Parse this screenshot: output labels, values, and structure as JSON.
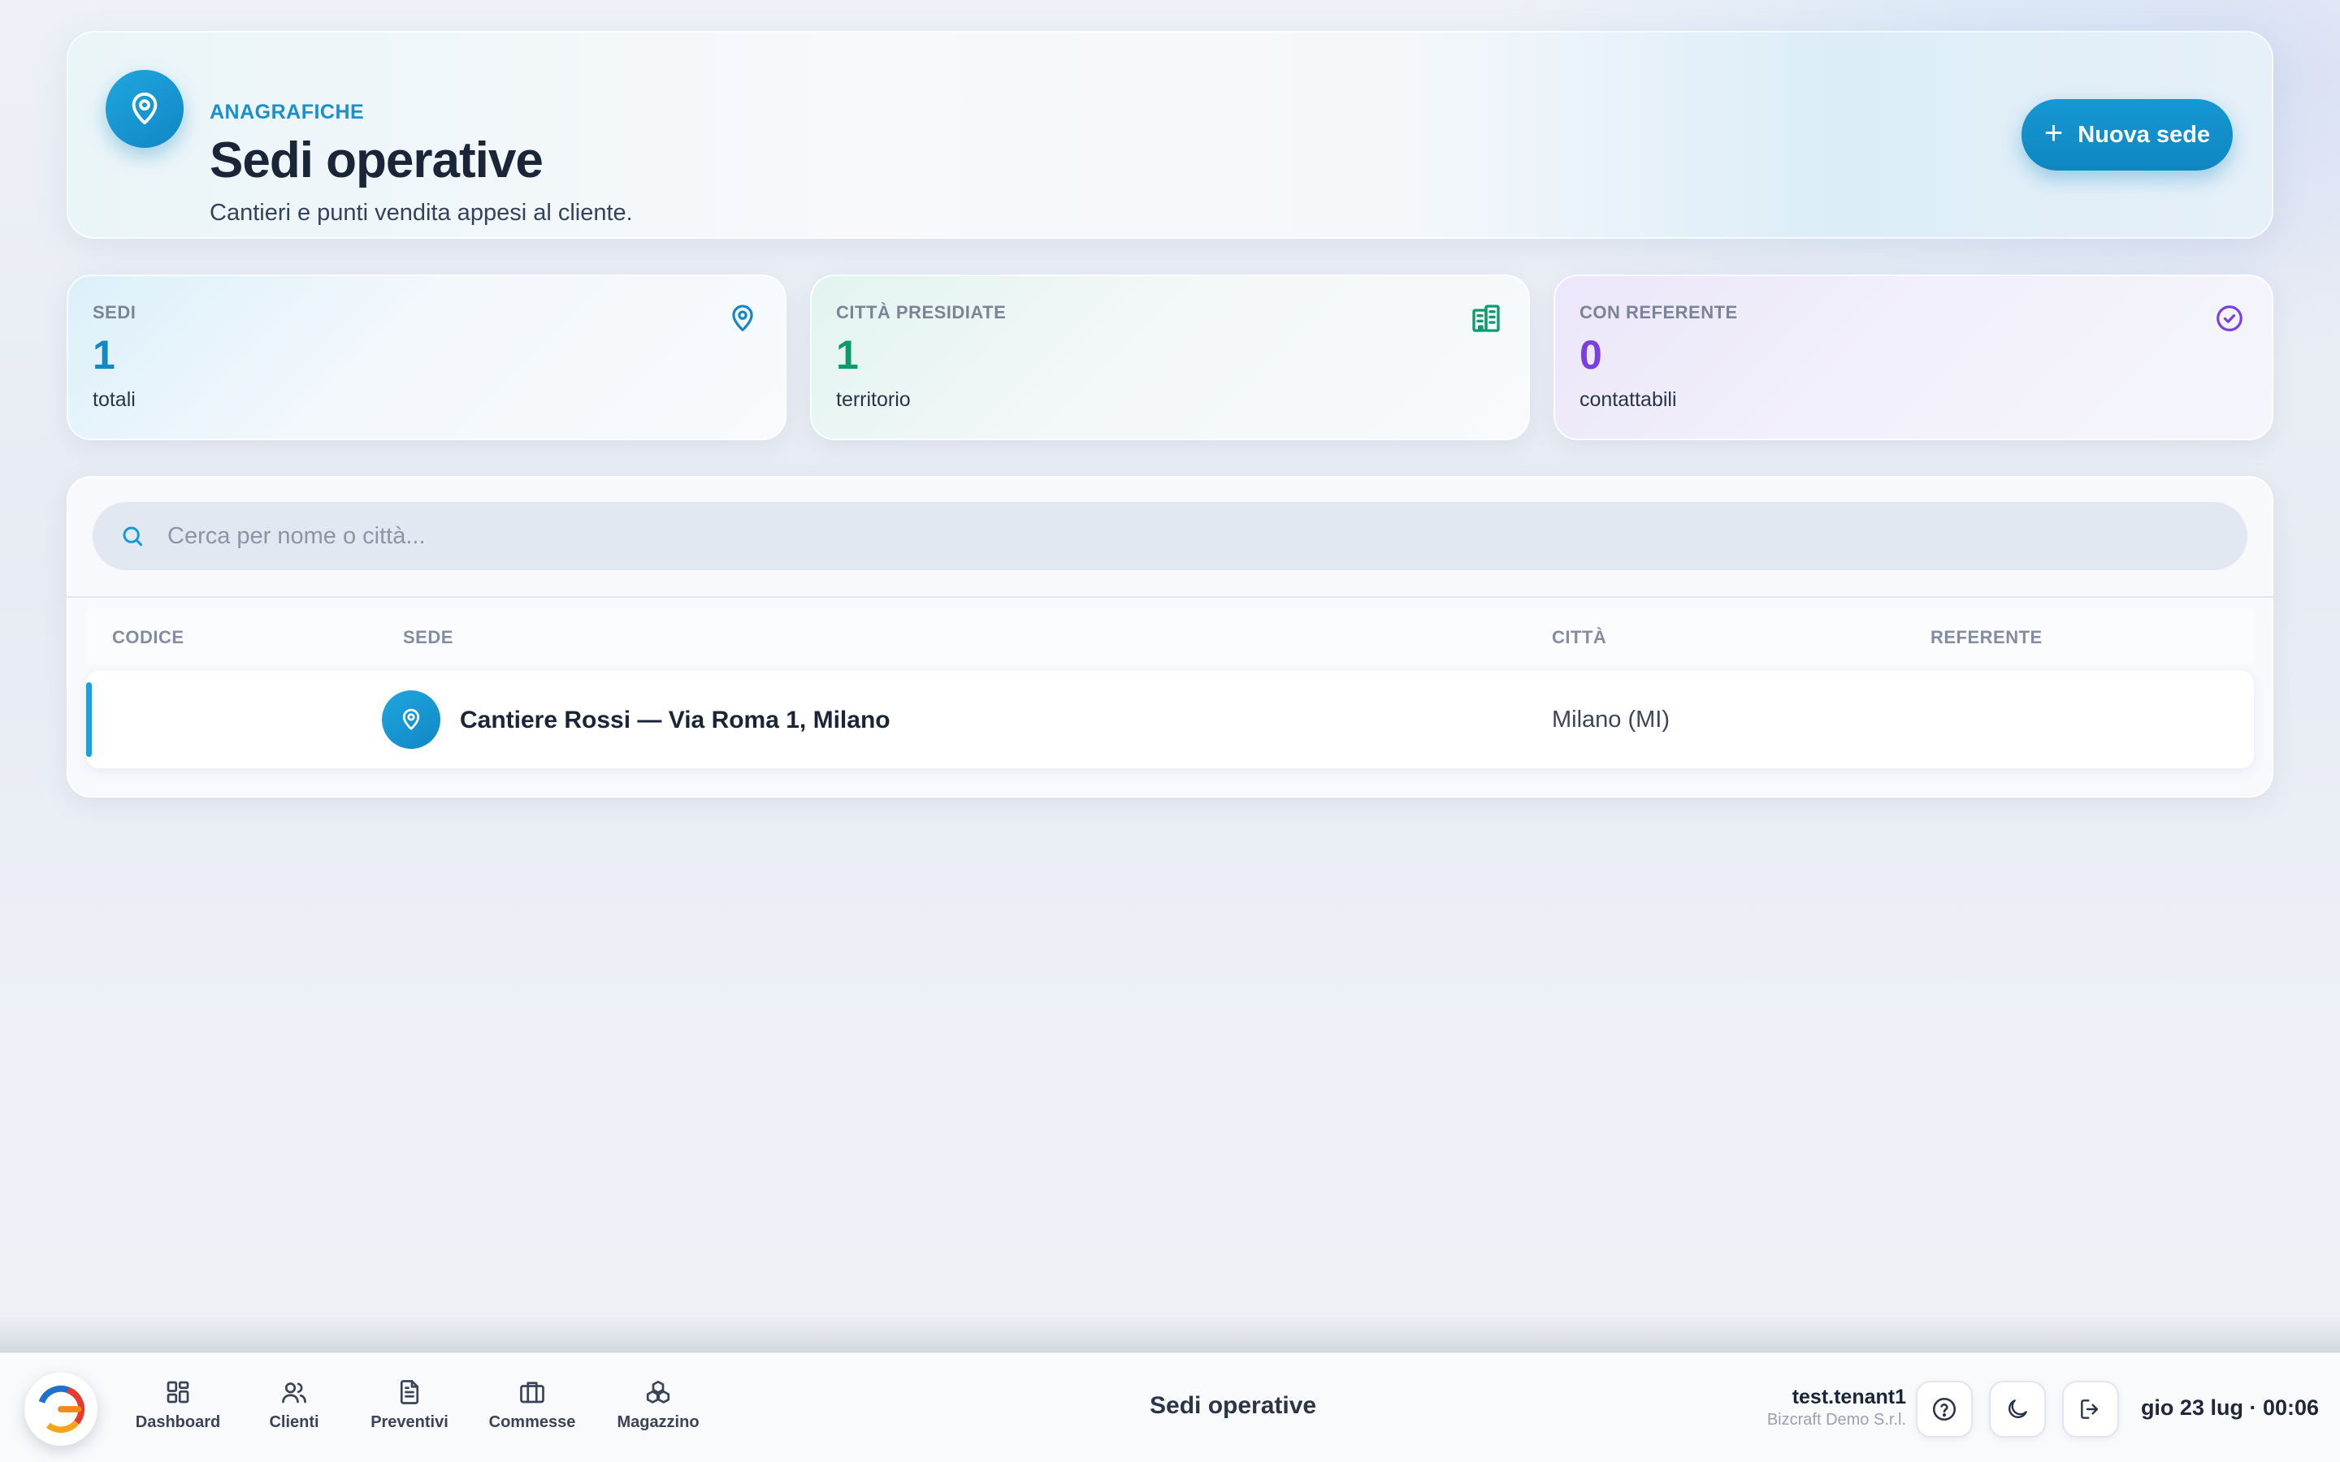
{
  "header": {
    "eyebrow": "ANAGRAFICHE",
    "title": "Sedi operative",
    "subtitle": "Cantieri e punti vendita appesi al cliente.",
    "new_button_label": "Nuova sede",
    "icon": "map-pin-icon"
  },
  "stats": [
    {
      "label": "SEDI",
      "value": "1",
      "sub": "totali",
      "icon": "map-pin-icon",
      "color": "#1587c6"
    },
    {
      "label": "CITTÀ PRESIDIATE",
      "value": "1",
      "sub": "territorio",
      "icon": "building-icon",
      "color": "#0f9a6e"
    },
    {
      "label": "CON REFERENTE",
      "value": "0",
      "sub": "contattabili",
      "icon": "check-circle-icon",
      "color": "#7b3fe0"
    }
  ],
  "search": {
    "placeholder": "Cerca per nome o città...",
    "value": ""
  },
  "table": {
    "columns": [
      "CODICE",
      "SEDE",
      "CITTÀ",
      "REFERENTE"
    ],
    "rows": [
      {
        "codice": "",
        "sede": "Cantiere Rossi — Via Roma 1, Milano",
        "citta": "Milano (MI)",
        "referente": ""
      }
    ]
  },
  "bottom_bar": {
    "nav": [
      {
        "label": "Dashboard",
        "icon": "dashboard-icon"
      },
      {
        "label": "Clienti",
        "icon": "users-icon"
      },
      {
        "label": "Preventivi",
        "icon": "document-icon"
      },
      {
        "label": "Commesse",
        "icon": "briefcase-icon"
      },
      {
        "label": "Magazzino",
        "icon": "boxes-icon"
      }
    ],
    "current_page": "Sedi operative",
    "user": "test.tenant1",
    "company": "Bizcraft Demo S.r.l.",
    "datetime": "gio 23 lug · 00:06"
  },
  "colors": {
    "accent": "#1598d4",
    "green": "#0f9a6e",
    "purple": "#7b3fe0"
  }
}
